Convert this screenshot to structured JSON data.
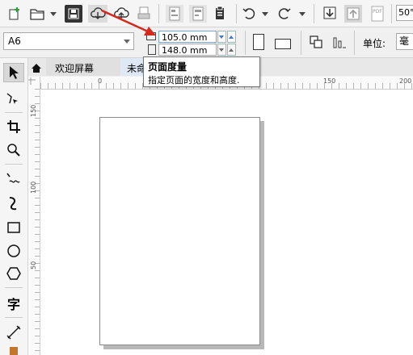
{
  "toolbar": {
    "icons": [
      "new-document-icon",
      "open-folder-icon",
      "save-icon",
      "cloud-import-icon",
      "cloud-export-icon",
      "print-icon",
      "import-icon",
      "export-icon",
      "publish-pdf-icon",
      "undo-icon",
      "redo-icon",
      "download-icon",
      "upload-icon",
      "pdf-icon"
    ],
    "zoom_value": "50°",
    "pdf_label": "PDF"
  },
  "property_bar": {
    "page_size": "A6",
    "width_value": "105.0 mm",
    "height_value": "148.0 mm",
    "unit_label": "单位:",
    "unit_value": "毫"
  },
  "tooltip": {
    "title": "页面度量",
    "description": "指定页面的宽度和高度."
  },
  "tabs": [
    {
      "label": "欢迎屏幕"
    },
    {
      "label": "未命"
    }
  ],
  "ruler": {
    "h_labels": [
      "0",
      "150",
      "200"
    ],
    "v_labels": [
      "150",
      "100",
      "50"
    ]
  },
  "toolbox": {
    "text_tool_glyph": "字"
  },
  "colors": {
    "accent": "#3c78c8",
    "arrow": "#d42a1e",
    "tab_active": "#dfe8f5"
  }
}
